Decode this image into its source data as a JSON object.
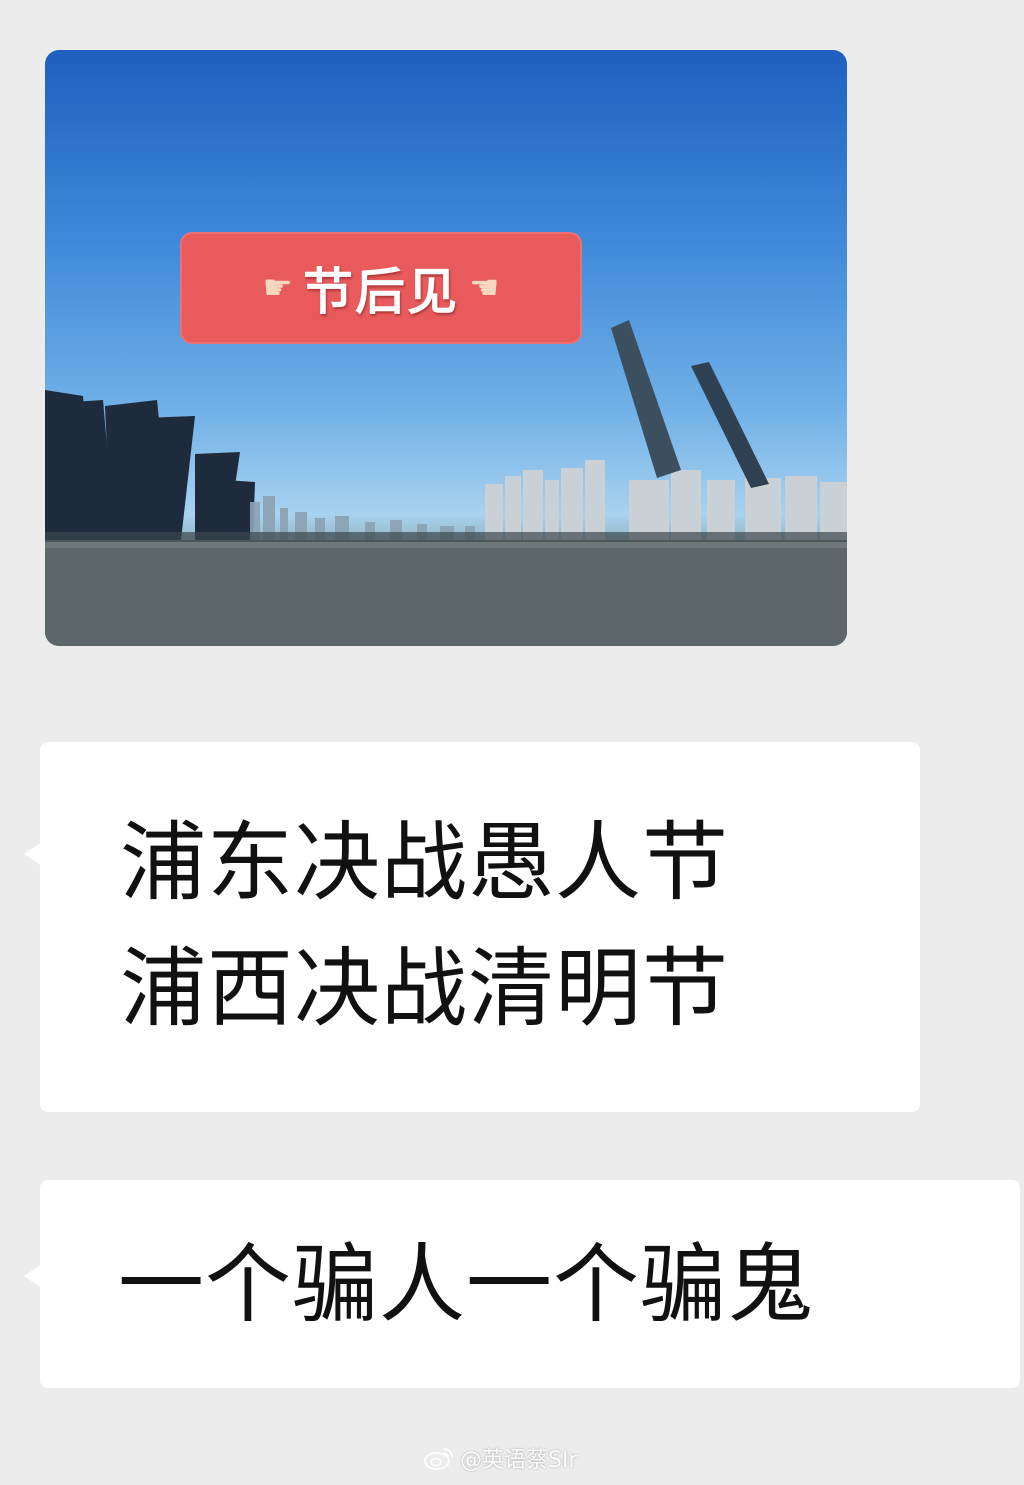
{
  "image_message": {
    "sticker_text": "节后见",
    "left_icon": "pointing-hand-right-icon",
    "right_icon": "pointing-hand-left-icon"
  },
  "messages": [
    {
      "lines": [
        "浦东决战愚人节",
        "浦西决战清明节"
      ]
    },
    {
      "lines": [
        "一个骗人一个骗鬼"
      ]
    }
  ],
  "watermark": {
    "icon": "weibo-icon",
    "text": "@英语蔡SIr"
  },
  "colors": {
    "background": "#ececec",
    "bubble": "#ffffff",
    "sticker": "#e85a5c",
    "sky": "#2a6fcb"
  }
}
